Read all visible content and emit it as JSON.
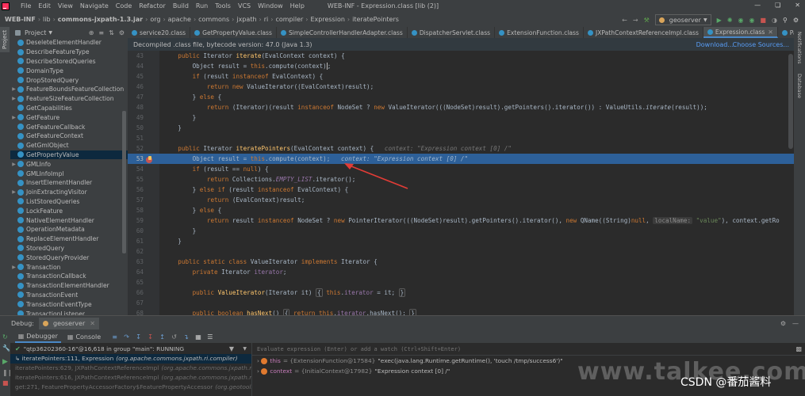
{
  "titlebar": {
    "menus": [
      "File",
      "Edit",
      "View",
      "Navigate",
      "Code",
      "Refactor",
      "Build",
      "Run",
      "Tools",
      "VCS",
      "Window",
      "Help"
    ],
    "title": "WEB-INF - Expression.class [lib (2)]"
  },
  "breadcrumb": [
    "WEB-INF",
    "lib",
    "commons-jxpath-1.3.jar",
    "org",
    "apache",
    "commons",
    "jxpath",
    "ri",
    "compiler",
    "Expression",
    "iteratePointers"
  ],
  "run_config": "geoserver",
  "project_panel": {
    "title": "Project",
    "items": [
      {
        "label": "DeseleteElementHandler",
        "expandable": false
      },
      {
        "label": "DescribeFeatureType",
        "expandable": false
      },
      {
        "label": "DescribeStoredQueries",
        "expandable": false
      },
      {
        "label": "DomainType",
        "expandable": false
      },
      {
        "label": "DropStoredQuery",
        "expandable": false
      },
      {
        "label": "FeatureBoundsFeatureCollection",
        "expandable": true
      },
      {
        "label": "FeatureSizeFeatureCollection",
        "expandable": true
      },
      {
        "label": "GetCapabilities",
        "expandable": false
      },
      {
        "label": "GetFeature",
        "expandable": true
      },
      {
        "label": "GetFeatureCallback",
        "expandable": false
      },
      {
        "label": "GetFeatureContext",
        "expandable": false
      },
      {
        "label": "GetGmlObject",
        "expandable": false
      },
      {
        "label": "GetPropertyValue",
        "expandable": false,
        "selected": true
      },
      {
        "label": "GMLInfo",
        "expandable": true
      },
      {
        "label": "GMLInfoImpl",
        "expandable": false
      },
      {
        "label": "InsertElementHandler",
        "expandable": false
      },
      {
        "label": "JoinExtractingVisitor",
        "expandable": true
      },
      {
        "label": "ListStoredQueries",
        "expandable": false
      },
      {
        "label": "LockFeature",
        "expandable": false
      },
      {
        "label": "NativeElementHandler",
        "expandable": false
      },
      {
        "label": "OperationMetadata",
        "expandable": false
      },
      {
        "label": "ReplaceElementHandler",
        "expandable": false
      },
      {
        "label": "StoredQuery",
        "expandable": false
      },
      {
        "label": "StoredQueryProvider",
        "expandable": false
      },
      {
        "label": "Transaction",
        "expandable": true
      },
      {
        "label": "TransactionCallback",
        "expandable": false
      },
      {
        "label": "TransactionElementHandler",
        "expandable": false
      },
      {
        "label": "TransactionEvent",
        "expandable": false
      },
      {
        "label": "TransactionEventType",
        "expandable": false
      },
      {
        "label": "TransactionListener",
        "expandable": false
      }
    ]
  },
  "tabs": [
    {
      "label": "service20.class"
    },
    {
      "label": "GetPropertyValue.class"
    },
    {
      "label": "SimpleControllerHandlerAdapter.class"
    },
    {
      "label": "DispatcherServlet.class"
    },
    {
      "label": "ExtensionFunction.class"
    },
    {
      "label": "JXPathContextReferenceImpl.class"
    },
    {
      "label": "Expression.class",
      "active": true
    },
    {
      "label": "Pa"
    }
  ],
  "banner": {
    "text": "Decompiled .class file, bytecode version: 47.0 (Java 1.3)",
    "download": "Download...",
    "choose_sources": "Choose Sources..."
  },
  "line_numbers": [
    "43",
    "44",
    "45",
    "46",
    "47",
    "48",
    "49",
    "50",
    "51",
    "52",
    "53",
    "54",
    "55",
    "56",
    "57",
    "58",
    "59",
    "60",
    "61",
    "62",
    "63",
    "64",
    "65",
    "66",
    "67",
    "68"
  ],
  "right_strip": [
    "Notifications",
    "Database"
  ],
  "debug": {
    "label": "Debug:",
    "session": "geoserver",
    "tabs": [
      "Debugger",
      "Console"
    ],
    "thread": "\"qtp36202360-16\"@16,618 in group \"main\": RUNNING",
    "evaluate_placeholder": "Evaluate expression (Enter) or add a watch (Ctrl+Shift+Enter)",
    "frames": [
      {
        "method": "iteratePointers:111, Expression",
        "pkg": "(org.apache.commons.jxpath.ri.compiler)",
        "selected": true
      },
      {
        "method": "iteratePointers:629, JXPathContextReferenceImpl",
        "pkg": "(org.apache.commons.jxpath.ri)"
      },
      {
        "method": "iteratePointers:616, JXPathContextReferenceImpl",
        "pkg": "(org.apache.commons.jxpath.ri)"
      },
      {
        "method": "get:271, FeaturePropertyAccessorFactory$FeaturePropertyAccessor",
        "pkg": "(org.geotools..."
      }
    ],
    "vars": [
      {
        "name": "this",
        "type": "= {ExtensionFunction@17584}",
        "value": "\"exec(java.lang.Runtime.getRuntime(), 'touch /tmp/success6')\"",
        "expanded": false
      },
      {
        "name": "context",
        "type": "= {InitialContext@17982}",
        "value": "\"Expression context [0] /\"",
        "expanded": false
      }
    ]
  },
  "watermark": "www.talkee.com",
  "csdn": "CSDN @番茄酱料"
}
